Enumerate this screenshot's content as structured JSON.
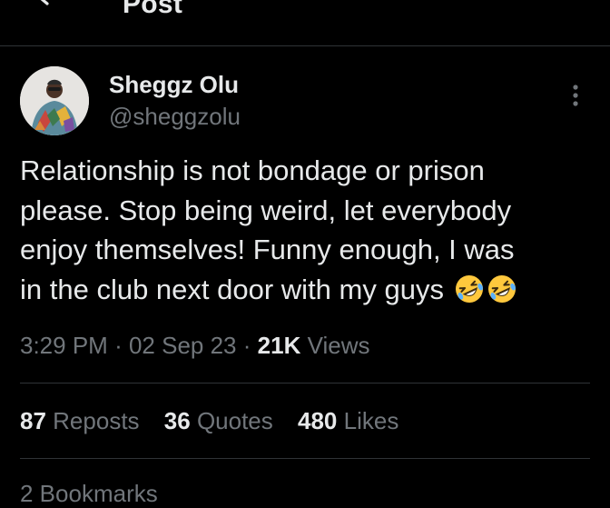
{
  "header": {
    "title": "Post",
    "back_icon": "back-arrow-icon"
  },
  "author": {
    "display_name": "Sheggz Olu",
    "handle": "@sheggzolu"
  },
  "post": {
    "lines": [
      "Relationship is not bondage or prison",
      "please. Stop being weird, let everybody",
      "enjoy themselves! Funny enough, I was",
      "in the club next door with my guys"
    ],
    "emojis": [
      "rolling-on-floor-laughing-emoji",
      "rolling-on-floor-laughing-emoji"
    ]
  },
  "meta": {
    "time": "3:29 PM",
    "date": "02 Sep 23",
    "views_count": "21K",
    "views_label": "Views",
    "separator": "·"
  },
  "stats": {
    "reposts_count": "87",
    "reposts_label": "Reposts",
    "quotes_count": "36",
    "quotes_label": "Quotes",
    "likes_count": "480",
    "likes_label": "Likes"
  },
  "bottom": {
    "partial_text": "2 Bookmarks"
  },
  "colors": {
    "background": "#000000",
    "primary_text": "#e7e9ea",
    "secondary_text": "#71767b",
    "divider": "#2f3336",
    "emoji_face": "#ffc83d"
  }
}
